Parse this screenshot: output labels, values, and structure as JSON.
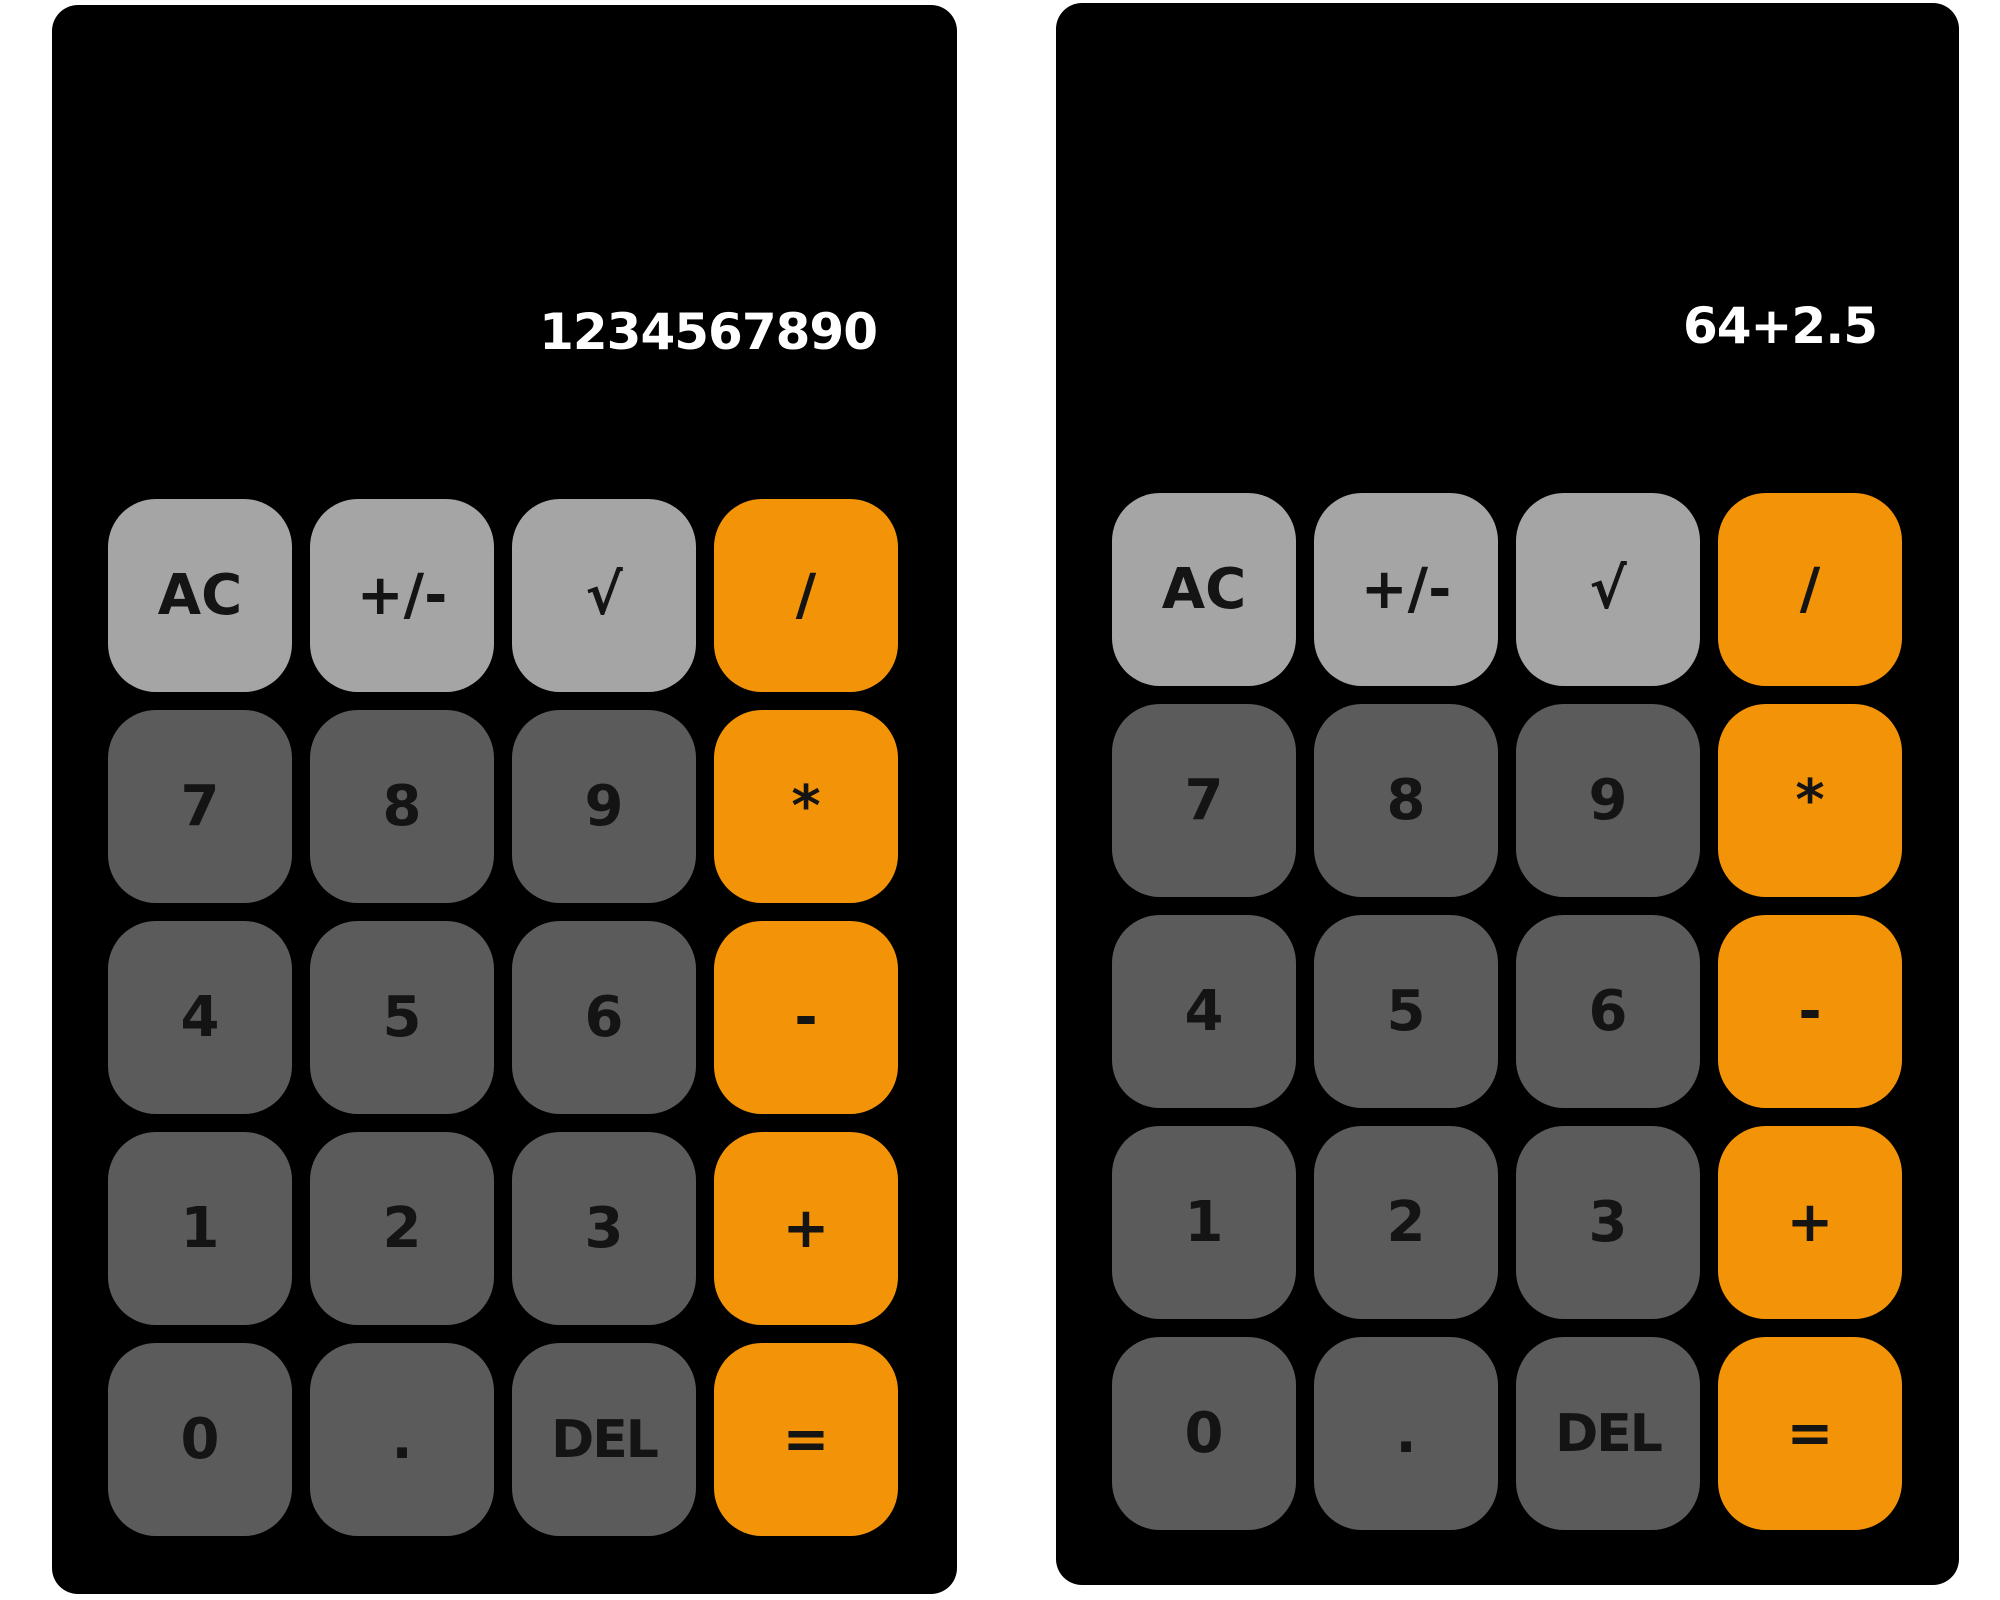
{
  "colors": {
    "body_background": "#000000",
    "function_key": "#a5a5a5",
    "number_key": "#5b5b5b",
    "operator_key": "#f39408",
    "key_text": "#141414",
    "display_text": "#ffffff"
  },
  "calculators": [
    {
      "display": "1234567890",
      "keys": [
        {
          "label": "AC",
          "kind": "func"
        },
        {
          "label": "+/-",
          "kind": "func"
        },
        {
          "label": "√",
          "kind": "func"
        },
        {
          "label": "/",
          "kind": "op"
        },
        {
          "label": "7",
          "kind": "num"
        },
        {
          "label": "8",
          "kind": "num"
        },
        {
          "label": "9",
          "kind": "num"
        },
        {
          "label": "*",
          "kind": "op"
        },
        {
          "label": "4",
          "kind": "num"
        },
        {
          "label": "5",
          "kind": "num"
        },
        {
          "label": "6",
          "kind": "num"
        },
        {
          "label": "-",
          "kind": "op"
        },
        {
          "label": "1",
          "kind": "num"
        },
        {
          "label": "2",
          "kind": "num"
        },
        {
          "label": "3",
          "kind": "num"
        },
        {
          "label": "+",
          "kind": "op"
        },
        {
          "label": "0",
          "kind": "num"
        },
        {
          "label": ".",
          "kind": "num"
        },
        {
          "label": "DEL",
          "kind": "num"
        },
        {
          "label": "=",
          "kind": "op"
        }
      ]
    },
    {
      "display": "64+2.5",
      "keys": [
        {
          "label": "AC",
          "kind": "func"
        },
        {
          "label": "+/-",
          "kind": "func"
        },
        {
          "label": "√",
          "kind": "func"
        },
        {
          "label": "/",
          "kind": "op"
        },
        {
          "label": "7",
          "kind": "num"
        },
        {
          "label": "8",
          "kind": "num"
        },
        {
          "label": "9",
          "kind": "num"
        },
        {
          "label": "*",
          "kind": "op"
        },
        {
          "label": "4",
          "kind": "num"
        },
        {
          "label": "5",
          "kind": "num"
        },
        {
          "label": "6",
          "kind": "num"
        },
        {
          "label": "-",
          "kind": "op"
        },
        {
          "label": "1",
          "kind": "num"
        },
        {
          "label": "2",
          "kind": "num"
        },
        {
          "label": "3",
          "kind": "num"
        },
        {
          "label": "+",
          "kind": "op"
        },
        {
          "label": "0",
          "kind": "num"
        },
        {
          "label": ".",
          "kind": "num"
        },
        {
          "label": "DEL",
          "kind": "num"
        },
        {
          "label": "=",
          "kind": "op"
        }
      ]
    }
  ]
}
